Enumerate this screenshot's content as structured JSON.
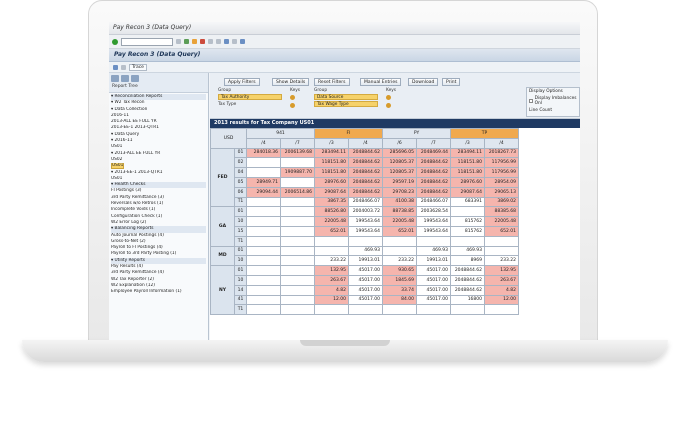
{
  "window": {
    "title": "Pay Recon 3 (Data Query)"
  },
  "app": {
    "title": "Pay Recon 3 (Data Query)",
    "trace_label": "Trace"
  },
  "tree": {
    "header": "Report Tree",
    "nodes": [
      {
        "label": "▾ Reconciliation Reports",
        "type": "sec"
      },
      {
        "label": "  ▾ W2 Tax Recon",
        "type": ""
      },
      {
        "label": "    ▾ Data Collection",
        "type": ""
      },
      {
        "label": "      2016-11",
        "type": ""
      },
      {
        "label": "      2013-ALL EE FULL YR",
        "type": ""
      },
      {
        "label": "      2013-EE-1 2013-QTR1",
        "type": ""
      },
      {
        "label": "    ▾ Data Query",
        "type": ""
      },
      {
        "label": "    ▾ 2016-11",
        "type": ""
      },
      {
        "label": "        US01",
        "type": ""
      },
      {
        "label": "    ▾ 2013-ALL EE FULL YR",
        "type": ""
      },
      {
        "label": "        US02",
        "type": ""
      },
      {
        "label": "        US01",
        "type": "sel"
      },
      {
        "label": "    ▾ 2013-EE-1 2013-QTR1",
        "type": ""
      },
      {
        "label": "        US01",
        "type": ""
      },
      {
        "label": "▾ Health Checks",
        "type": "sec"
      },
      {
        "label": "  FI Postings (3)",
        "type": ""
      },
      {
        "label": "  3rd Party Remittance (3)",
        "type": ""
      },
      {
        "label": "  Reversals w/o Retros (1)",
        "type": ""
      },
      {
        "label": "  Incomplete Voids (1)",
        "type": ""
      },
      {
        "label": "  Configuration Check (1)",
        "type": ""
      },
      {
        "label": "  W2 Error Log (2)",
        "type": ""
      },
      {
        "label": "▾ Balancing Reports",
        "type": "sec"
      },
      {
        "label": "  Auto Journal Postings (4)",
        "type": ""
      },
      {
        "label": "  Gross-to-Net (2)",
        "type": ""
      },
      {
        "label": "  Payroll to FI Postings (4)",
        "type": ""
      },
      {
        "label": "  Payroll to 3rd Party Posting (1)",
        "type": ""
      },
      {
        "label": "▾ Utility Reports",
        "type": "sec"
      },
      {
        "label": "  Pay Results (4)",
        "type": ""
      },
      {
        "label": "  3rd Party Remittance (4)",
        "type": ""
      },
      {
        "label": "  W2 Tax Reporter (2)",
        "type": ""
      },
      {
        "label": "  W2 Explanation (12)",
        "type": ""
      },
      {
        "label": "  Employee Payroll Information (1)",
        "type": ""
      }
    ]
  },
  "filters": {
    "buttons": [
      "Apply Filters",
      "Show Details",
      "Reset Filters",
      "Manual Entries",
      "Download",
      "Print"
    ],
    "group_label": "Group",
    "keys_label": "Keys",
    "group1": [
      "Tax Authority",
      "Tax Type"
    ],
    "group2": [
      "Data Source",
      "Tax Wage Type"
    ],
    "display_options": {
      "title": "Display Options",
      "imbalances": "Display Imbalances Onl",
      "line_count": "Line Count"
    }
  },
  "results": {
    "title": "2013 results for Tax Company US01",
    "corner": "USD",
    "groups": [
      "941",
      "FI",
      "PY",
      "TP"
    ],
    "subcols": [
      "/4",
      "/7",
      "/3",
      "/4",
      "/6",
      "/7",
      "/3",
      "/4"
    ],
    "rows": [
      {
        "state": "FED",
        "code": "01",
        "cells": [
          [
            "284018.36",
            "p"
          ],
          [
            "2006139.68",
            "p"
          ],
          [
            "283494.11",
            "p"
          ],
          [
            "2048844.62",
            "p"
          ],
          [
            "285696.05",
            "p"
          ],
          [
            "2048469.44",
            "p"
          ],
          [
            "283494.11",
            "p"
          ],
          [
            "2018267.73",
            "p"
          ]
        ]
      },
      {
        "state": "",
        "code": "02",
        "cells": [
          [
            "",
            ""
          ],
          [
            "",
            ""
          ],
          [
            "118151.80",
            "p"
          ],
          [
            "2048844.62",
            "p"
          ],
          [
            "120805.37",
            "p"
          ],
          [
            "2048844.62",
            "p"
          ],
          [
            "118151.80",
            "p"
          ],
          [
            "117956.99",
            "p"
          ]
        ]
      },
      {
        "state": "",
        "code": "04",
        "cells": [
          [
            "",
            ""
          ],
          [
            "1909887.70",
            "p"
          ],
          [
            "118151.80",
            "p"
          ],
          [
            "2048844.62",
            "p"
          ],
          [
            "120805.37",
            "p"
          ],
          [
            "2048844.62",
            "p"
          ],
          [
            "118151.80",
            "p"
          ],
          [
            "117956.99",
            "p"
          ]
        ]
      },
      {
        "state": "",
        "code": "05",
        "cells": [
          [
            "28949.71",
            "p"
          ],
          [
            "",
            ""
          ],
          [
            "28976.60",
            "p"
          ],
          [
            "2048844.62",
            "p"
          ],
          [
            "29597.19",
            "p"
          ],
          [
            "2048844.62",
            "p"
          ],
          [
            "28976.60",
            "p"
          ],
          [
            "28954.09",
            "p"
          ]
        ]
      },
      {
        "state": "",
        "code": "06",
        "cells": [
          [
            "29094.44",
            "p"
          ],
          [
            "2006514.86",
            "p"
          ],
          [
            "29087.64",
            "p"
          ],
          [
            "2048844.62",
            "p"
          ],
          [
            "29708.23",
            "p"
          ],
          [
            "2048844.62",
            "p"
          ],
          [
            "29087.64",
            "p"
          ],
          [
            "29065.13",
            "p"
          ]
        ]
      },
      {
        "state": "",
        "code": "T1",
        "cells": [
          [
            "",
            ""
          ],
          [
            "",
            ""
          ],
          [
            "3867.35",
            "p"
          ],
          [
            "2048466.07",
            ""
          ],
          [
            "4100.38",
            "p"
          ],
          [
            "2048466.07",
            ""
          ],
          [
            "683391",
            ""
          ],
          [
            "3869.02",
            "p"
          ]
        ]
      },
      {
        "state": "GA",
        "code": "01",
        "cells": [
          [
            "",
            ""
          ],
          [
            "",
            ""
          ],
          [
            "88526.80",
            "p"
          ],
          [
            "2004003.72",
            ""
          ],
          [
            "88738.85",
            "p"
          ],
          [
            "2003628.54",
            ""
          ],
          [
            "",
            ""
          ],
          [
            "88385.68",
            "p"
          ]
        ]
      },
      {
        "state": "",
        "code": "10",
        "cells": [
          [
            "",
            ""
          ],
          [
            "",
            ""
          ],
          [
            "22005.48",
            "p"
          ],
          [
            "199543.64",
            ""
          ],
          [
            "22005.48",
            "p"
          ],
          [
            "199543.64",
            ""
          ],
          [
            "815762",
            ""
          ],
          [
            "22005.48",
            "p"
          ]
        ]
      },
      {
        "state": "",
        "code": "15",
        "cells": [
          [
            "",
            ""
          ],
          [
            "",
            ""
          ],
          [
            "652.01",
            "p"
          ],
          [
            "199543.64",
            ""
          ],
          [
            "652.01",
            "p"
          ],
          [
            "199543.64",
            ""
          ],
          [
            "815762",
            ""
          ],
          [
            "652.01",
            "p"
          ]
        ]
      },
      {
        "state": "",
        "code": "T1",
        "cells": [
          [
            "",
            ""
          ],
          [
            "",
            ""
          ],
          [
            "",
            ""
          ],
          [
            "",
            ""
          ],
          [
            "",
            ""
          ],
          [
            "",
            ""
          ],
          [
            "",
            ""
          ],
          [
            "",
            ""
          ]
        ]
      },
      {
        "state": "MD",
        "code": "01",
        "cells": [
          [
            "",
            ""
          ],
          [
            "",
            ""
          ],
          [
            "",
            ""
          ],
          [
            "469.93",
            ""
          ],
          [
            "",
            ""
          ],
          [
            "469.93",
            ""
          ],
          [
            "469.93",
            ""
          ],
          [
            "",
            ""
          ]
        ]
      },
      {
        "state": "",
        "code": "10",
        "cells": [
          [
            "",
            ""
          ],
          [
            "",
            ""
          ],
          [
            "233.22",
            ""
          ],
          [
            "19913.01",
            ""
          ],
          [
            "233.22",
            ""
          ],
          [
            "19913.01",
            ""
          ],
          [
            "8969",
            ""
          ],
          [
            "233.22",
            ""
          ]
        ]
      },
      {
        "state": "NY",
        "code": "01",
        "cells": [
          [
            "",
            ""
          ],
          [
            "",
            ""
          ],
          [
            "132.95",
            "p"
          ],
          [
            "45017.00",
            ""
          ],
          [
            "930.65",
            "p"
          ],
          [
            "45017.00",
            ""
          ],
          [
            "2048844.62",
            ""
          ],
          [
            "132.95",
            "p"
          ]
        ]
      },
      {
        "state": "",
        "code": "10",
        "cells": [
          [
            "",
            ""
          ],
          [
            "",
            ""
          ],
          [
            "263.67",
            "p"
          ],
          [
            "45017.00",
            ""
          ],
          [
            "1845.69",
            "p"
          ],
          [
            "45017.00",
            ""
          ],
          [
            "2048844.62",
            ""
          ],
          [
            "263.67",
            "p"
          ]
        ]
      },
      {
        "state": "",
        "code": "14",
        "cells": [
          [
            "",
            ""
          ],
          [
            "",
            ""
          ],
          [
            "4.82",
            "p"
          ],
          [
            "45017.00",
            ""
          ],
          [
            "33.74",
            "p"
          ],
          [
            "45017.00",
            ""
          ],
          [
            "2048844.62",
            ""
          ],
          [
            "4.82",
            "p"
          ]
        ]
      },
      {
        "state": "",
        "code": "41",
        "cells": [
          [
            "",
            ""
          ],
          [
            "",
            ""
          ],
          [
            "12.00",
            "p"
          ],
          [
            "45017.00",
            ""
          ],
          [
            "84.00",
            "p"
          ],
          [
            "45017.00",
            ""
          ],
          [
            "16800",
            ""
          ],
          [
            "12.00",
            "p"
          ]
        ]
      },
      {
        "state": "",
        "code": "T1",
        "cells": [
          [
            "",
            ""
          ],
          [
            "",
            ""
          ],
          [
            "",
            ""
          ],
          [
            "",
            ""
          ],
          [
            "",
            ""
          ],
          [
            "",
            ""
          ],
          [
            "",
            ""
          ],
          [
            "",
            ""
          ]
        ]
      }
    ]
  }
}
